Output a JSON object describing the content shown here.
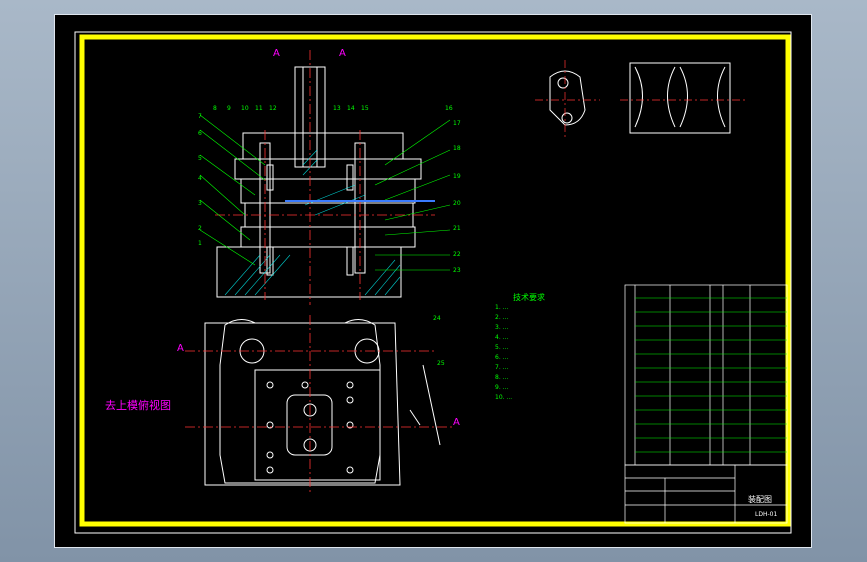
{
  "section_marks": {
    "top_left": "A",
    "top_right": "A",
    "mid_left": "A",
    "mid_right": "A"
  },
  "view_title": "去上模俯视图",
  "callout_numbers": [
    "1",
    "2",
    "3",
    "4",
    "5",
    "6",
    "7",
    "8",
    "9",
    "10",
    "11",
    "12",
    "13",
    "14",
    "15",
    "16",
    "17",
    "18",
    "19",
    "20",
    "21",
    "22",
    "23",
    "24",
    "25"
  ],
  "tech_requirements": {
    "title": "技术要求",
    "lines": [
      "1. ...",
      "2. ...",
      "3. ...",
      "4. ...",
      "5. ...",
      "6. ...",
      "7. ...",
      "8. ...",
      "9. ...",
      "10. ..."
    ]
  },
  "title_block": {
    "drawing_name": "装配图",
    "drawing_number": "LDH-01"
  },
  "colors": {
    "frame": "#ffff00",
    "geometry": "#ffffff",
    "centerline": "#ff3333",
    "annotation": "#00ff00",
    "label": "#ff00ff",
    "hatch": "#00ffff",
    "background": "#000000",
    "window": "#8a9bb0"
  }
}
